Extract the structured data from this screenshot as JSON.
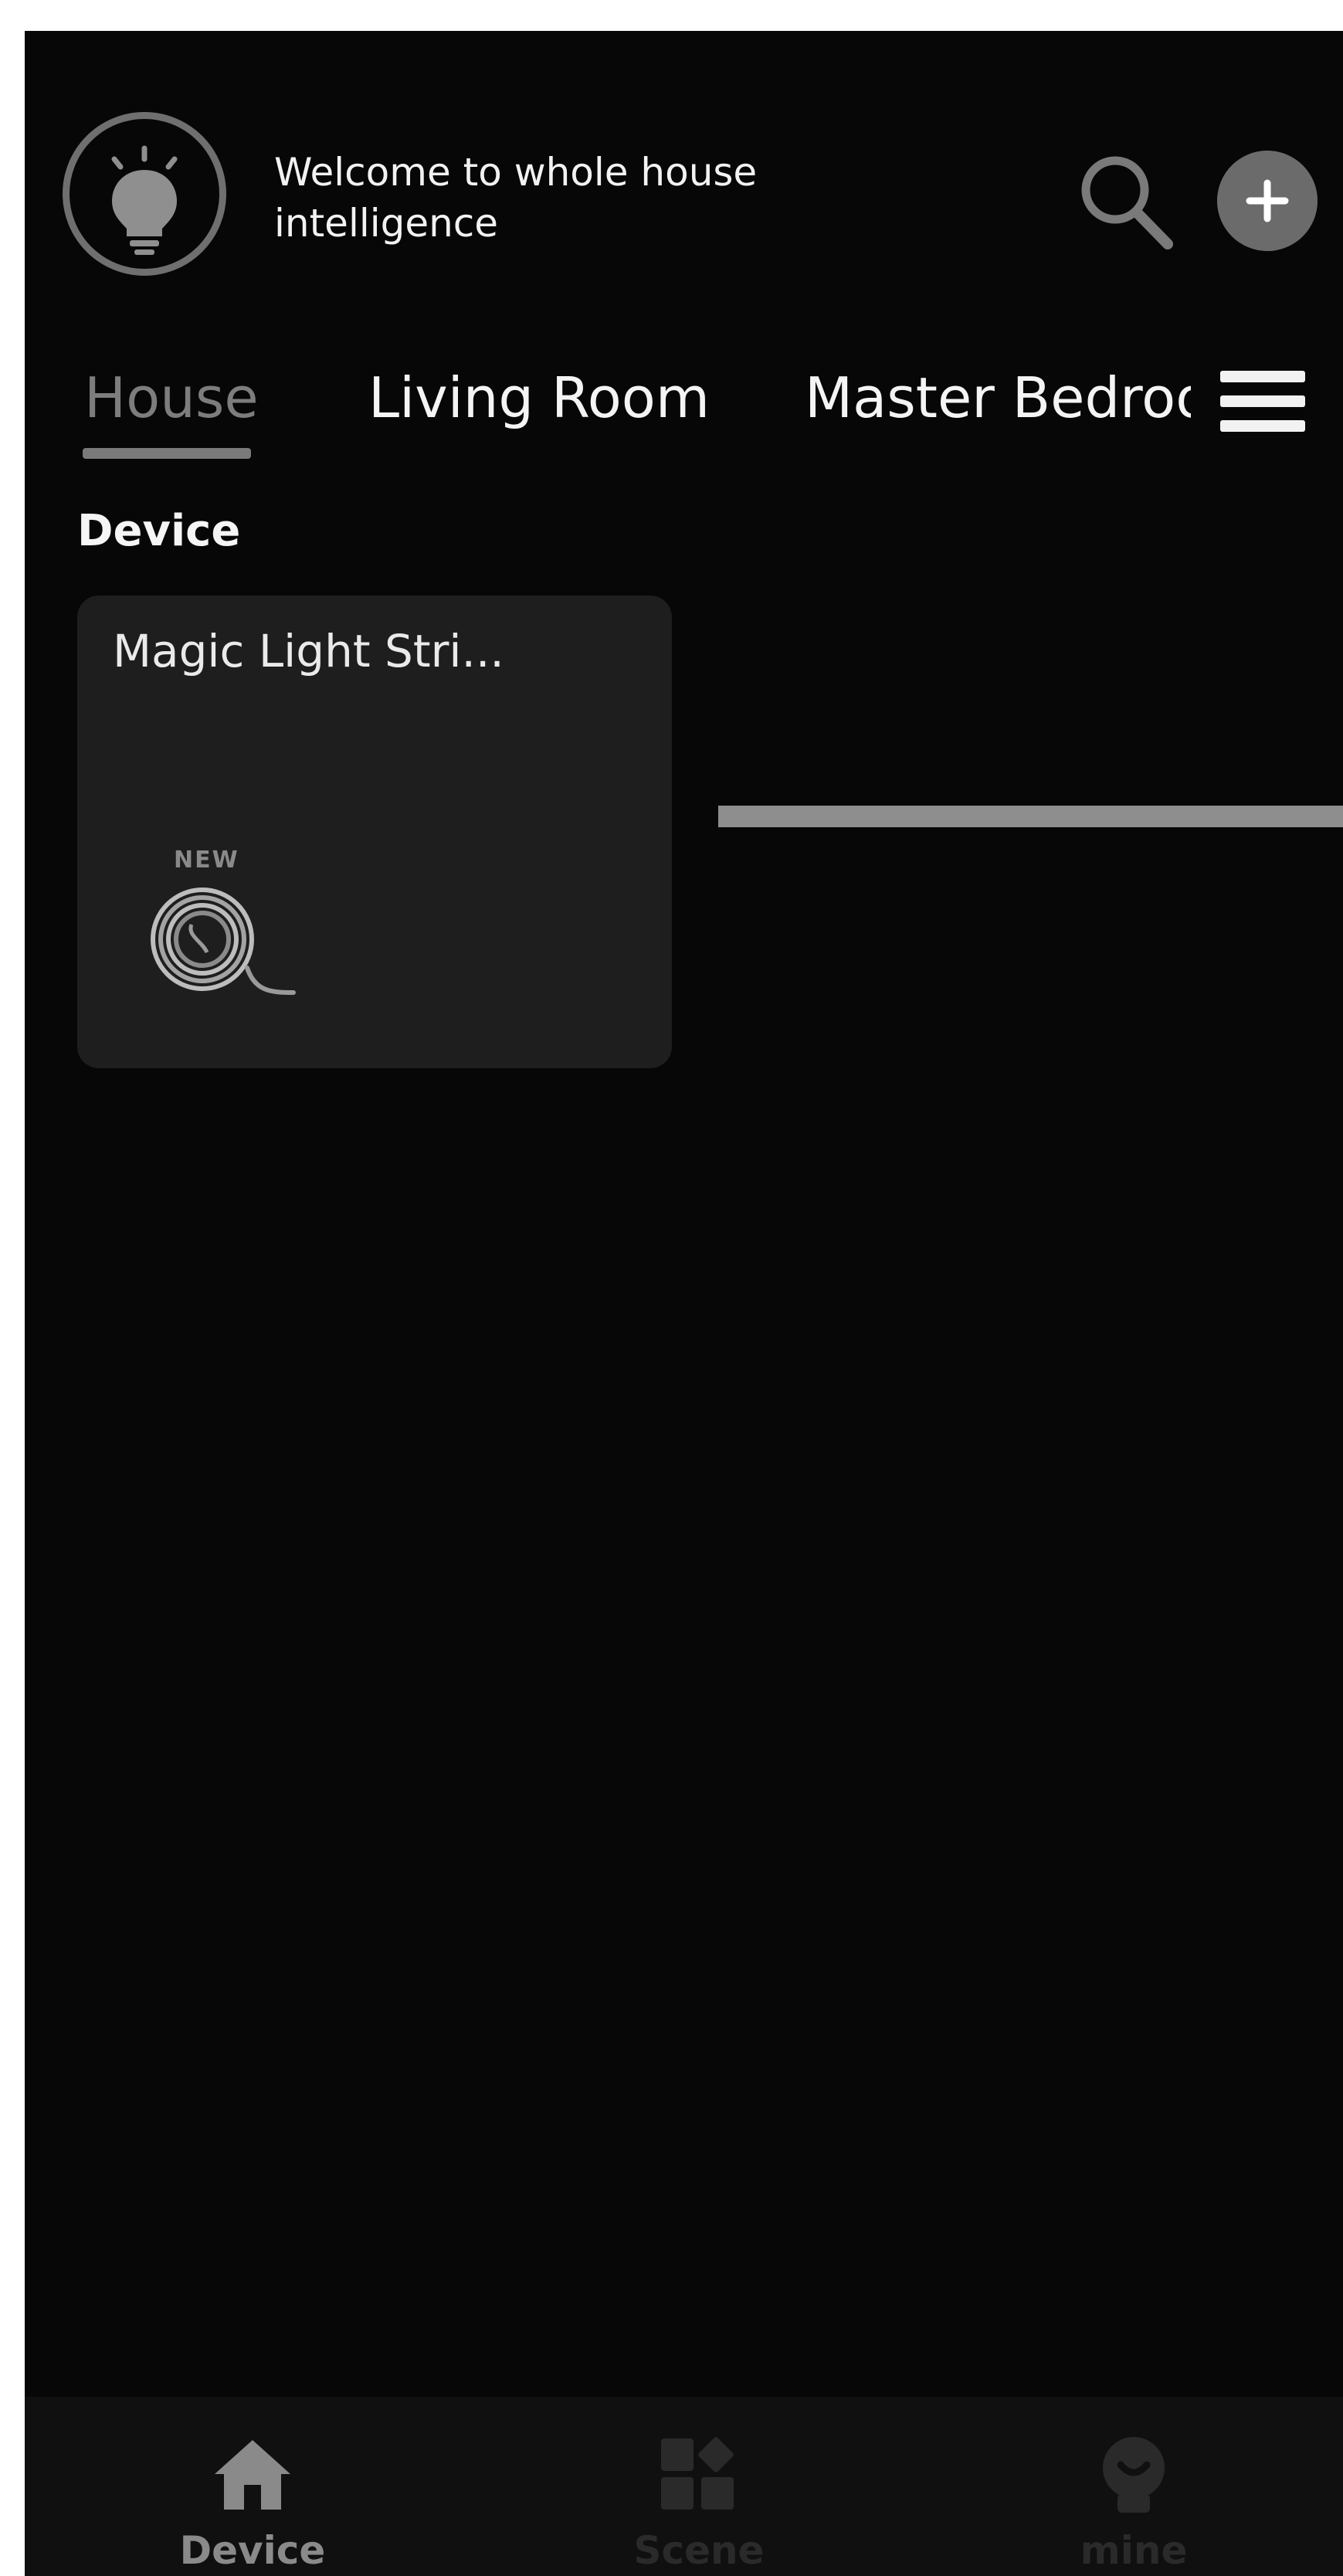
{
  "header": {
    "welcome_text": "Welcome to whole house intelligence",
    "avatar_icon": "lightbulb-icon",
    "search_icon": "search-icon",
    "add_icon": "plus-icon"
  },
  "tabs": [
    {
      "label": "House",
      "active": true
    },
    {
      "label": "Living Room",
      "active": false
    },
    {
      "label": "Master Bedroom",
      "active": false
    }
  ],
  "menu_icon": "hamburger-menu-icon",
  "section": {
    "title": "Device"
  },
  "devices": [
    {
      "name": "Magic Light Stri...",
      "badge": "NEW",
      "icon": "light-strip-coil-icon"
    }
  ],
  "bottom_nav": [
    {
      "label": "Device",
      "icon": "home-icon",
      "active": true
    },
    {
      "label": "Scene",
      "icon": "scene-grid-icon",
      "active": false
    },
    {
      "label": "mine",
      "icon": "profile-icon",
      "active": false
    }
  ],
  "colors": {
    "background": "#070707",
    "card": "#1e1e1e",
    "active_tab": "#7d7d7d",
    "inactive_nav": "#2a2a2a",
    "active_nav": "#8a8a8a"
  }
}
